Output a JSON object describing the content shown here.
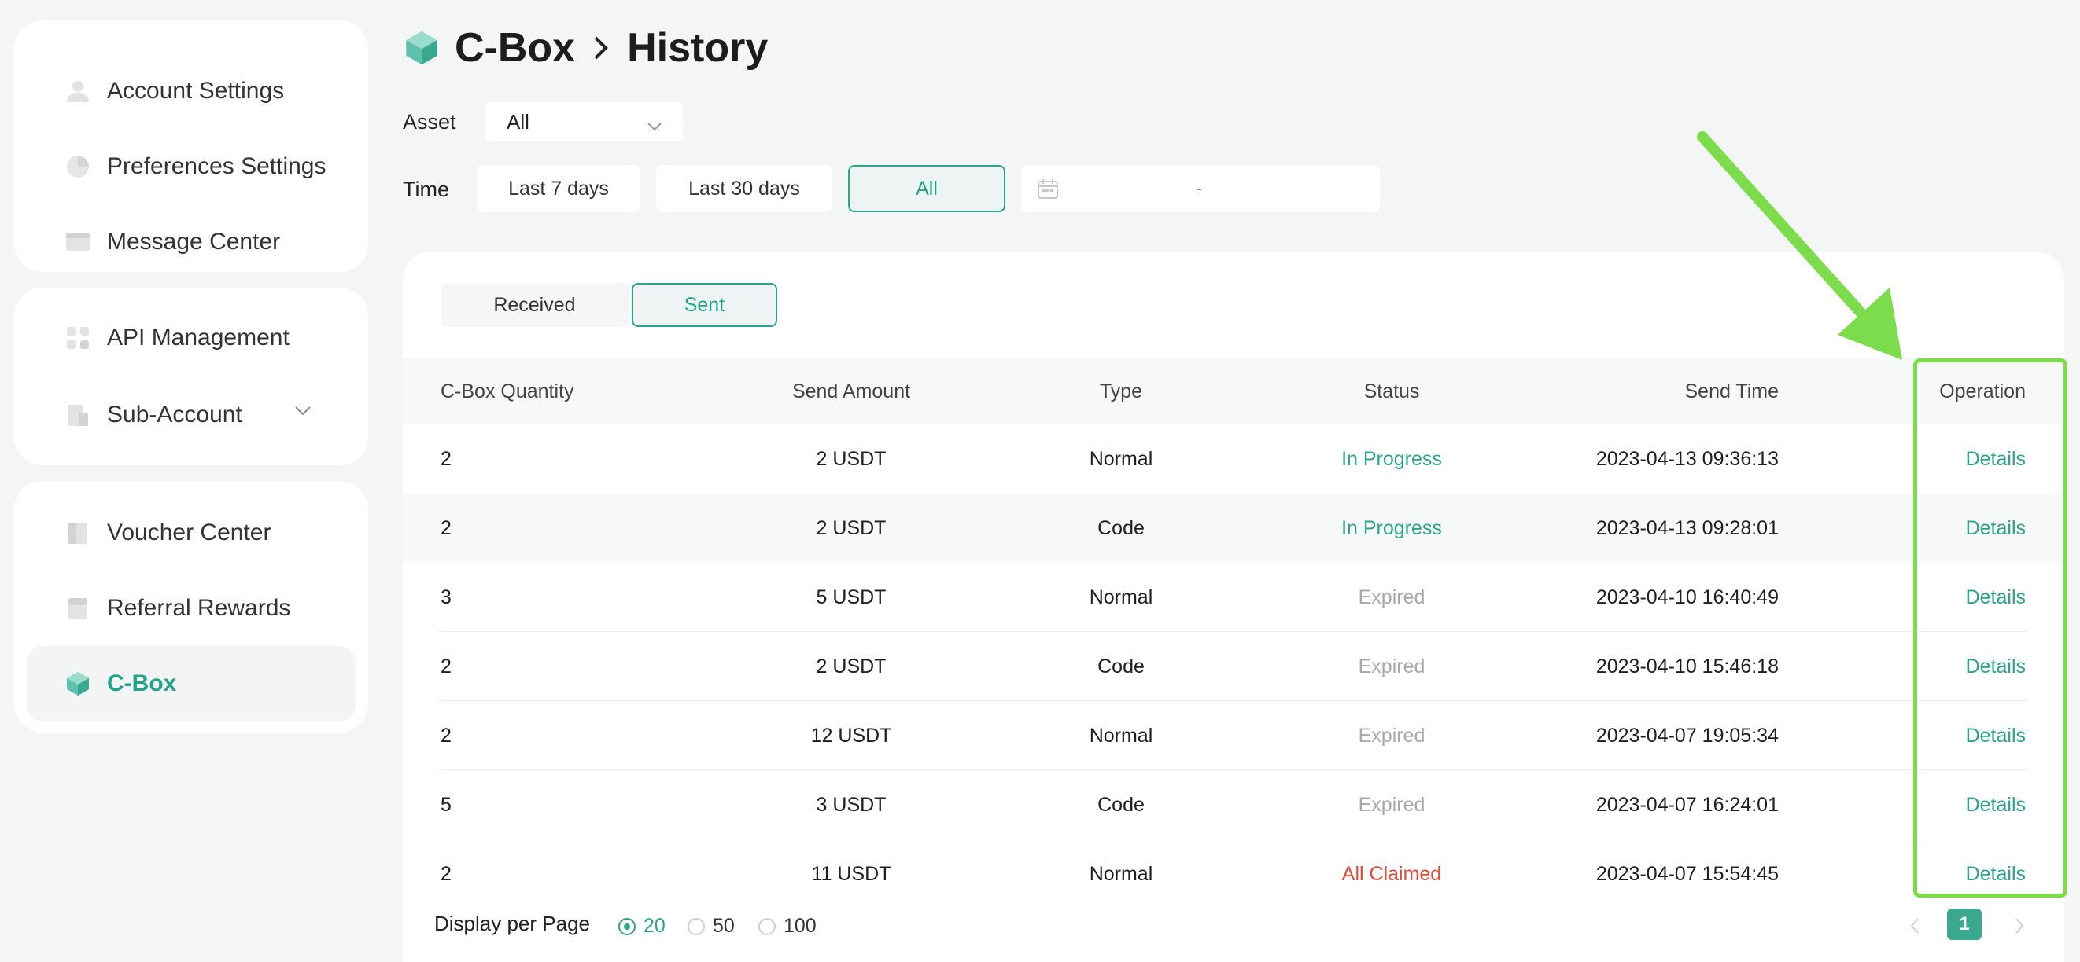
{
  "colors": {
    "accent": "#2aa58b",
    "expired": "#a9a9a9",
    "claimed": "#e04a3a",
    "annotation": "#7ddc4b"
  },
  "sidebar": {
    "groups": [
      [
        {
          "label": "Account Settings",
          "icon": "user-icon"
        },
        {
          "label": "Preferences Settings",
          "icon": "preferences-icon"
        },
        {
          "label": "Message Center",
          "icon": "message-icon"
        }
      ],
      [
        {
          "label": "API Management",
          "icon": "api-icon"
        },
        {
          "label": "Sub-Account",
          "icon": "sub-account-icon"
        }
      ],
      [
        {
          "label": "Voucher Center",
          "icon": "voucher-icon"
        },
        {
          "label": "Referral Rewards",
          "icon": "referral-icon"
        },
        {
          "label": "C-Box",
          "icon": "cbox-icon",
          "active": true
        }
      ]
    ]
  },
  "header": {
    "crumb_parent": "C-Box",
    "crumb_current": "History"
  },
  "filters": {
    "asset_label": "Asset",
    "asset_value": "All",
    "time_label": "Time",
    "time_options": [
      "Last 7 days",
      "Last 30 days",
      "All"
    ],
    "time_selected": "All",
    "date_separator": "-"
  },
  "tabs": {
    "received": "Received",
    "sent": "Sent",
    "selected": "Sent"
  },
  "table": {
    "columns": [
      "C-Box Quantity",
      "Send Amount",
      "Type",
      "Status",
      "Send Time",
      "Operation"
    ],
    "rows": [
      {
        "qty": "2",
        "amount": "2 USDT",
        "type": "Normal",
        "status": "In Progress",
        "time": "2023-04-13 09:36:13",
        "op": "Details"
      },
      {
        "qty": "2",
        "amount": "2 USDT",
        "type": "Code",
        "status": "In Progress",
        "time": "2023-04-13 09:28:01",
        "op": "Details"
      },
      {
        "qty": "3",
        "amount": "5 USDT",
        "type": "Normal",
        "status": "Expired",
        "time": "2023-04-10 16:40:49",
        "op": "Details"
      },
      {
        "qty": "2",
        "amount": "2 USDT",
        "type": "Code",
        "status": "Expired",
        "time": "2023-04-10 15:46:18",
        "op": "Details"
      },
      {
        "qty": "2",
        "amount": "12 USDT",
        "type": "Normal",
        "status": "Expired",
        "time": "2023-04-07 19:05:34",
        "op": "Details"
      },
      {
        "qty": "5",
        "amount": "3 USDT",
        "type": "Code",
        "status": "Expired",
        "time": "2023-04-07 16:24:01",
        "op": "Details"
      },
      {
        "qty": "2",
        "amount": "11 USDT",
        "type": "Normal",
        "status": "All Claimed",
        "time": "2023-04-07 15:54:45",
        "op": "Details"
      }
    ]
  },
  "pagination": {
    "per_page_label": "Display per Page",
    "per_page_options": [
      "20",
      "50",
      "100"
    ],
    "per_page_selected": "20",
    "current_page": "1"
  }
}
